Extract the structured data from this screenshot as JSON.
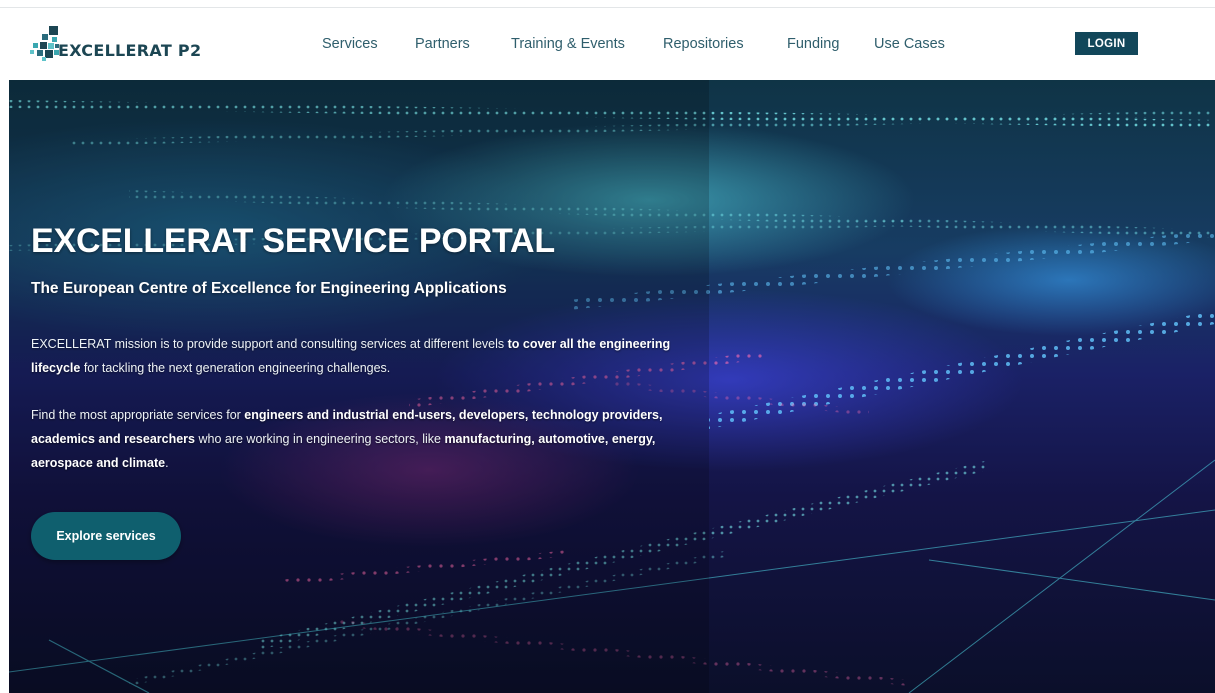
{
  "brand": {
    "name": "EXCELLERAT P2",
    "logo_icon": "pixel-cluster-logo-icon",
    "colors": {
      "brand": "#1c4653",
      "accent": "#12475a",
      "cta": "#0f5f6e"
    }
  },
  "nav": {
    "items": [
      {
        "label": "Services"
      },
      {
        "label": "Partners"
      },
      {
        "label": "Training & Events"
      },
      {
        "label": "Repositories"
      },
      {
        "label": "Funding"
      },
      {
        "label": "Use Cases"
      }
    ],
    "login_label": "LOGIN"
  },
  "hero": {
    "title": "EXCELLERAT SERVICE PORTAL",
    "subtitle": "The European Centre of Excellence for Engineering Applications",
    "p1": {
      "a": "EXCELLERAT mission is to provide support and consulting services at different levels ",
      "b": "to cover all the engineering lifecycle",
      "c": " for tackling the next generation engineering challenges."
    },
    "p2": {
      "a": "Find the most appropriate services for ",
      "b": "engineers and industrial end-users, developers, technology providers, academics and researchers",
      "c": " who are working in engineering sectors, like ",
      "d": "manufacturing, automotive, energy, aerospace and climate",
      "e": "."
    },
    "cta_label": "Explore services"
  }
}
